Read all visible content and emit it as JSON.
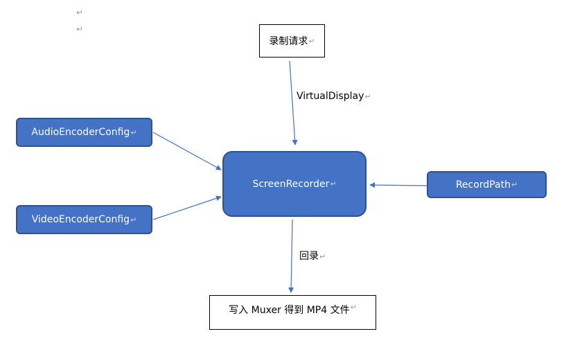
{
  "paragraph_mark": "↵",
  "nodes": {
    "record_request": "录制请求",
    "audio_config": "AudioEncoderConfig",
    "video_config": "VideoEncoderConfig",
    "screen_recorder": "ScreenRecorder",
    "record_path": "RecordPath",
    "output": "写入 Muxer 得到 MP4 文件"
  },
  "edge_labels": {
    "virtual_display": "VirtualDisplay",
    "callback": "回录"
  },
  "colors": {
    "node_fill": "#4472c4",
    "node_border": "#2f528f",
    "arrow": "#4472c4"
  }
}
